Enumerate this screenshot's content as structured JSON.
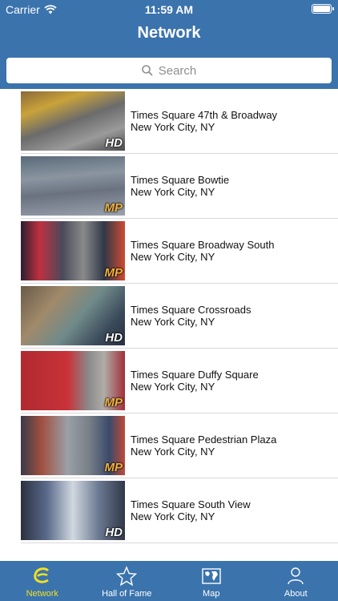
{
  "status_bar": {
    "carrier": "Carrier",
    "time": "11:59 AM"
  },
  "nav": {
    "title": "Network"
  },
  "search": {
    "placeholder": "Search"
  },
  "cameras": [
    {
      "name": "Times Square 47th & Broadway",
      "location": "New York City, NY",
      "quality": "HD"
    },
    {
      "name": "Times Square Bowtie",
      "location": "New York City, NY",
      "quality": "MP"
    },
    {
      "name": "Times Square Broadway South",
      "location": "New York City, NY",
      "quality": "MP"
    },
    {
      "name": "Times Square Crossroads",
      "location": "New York City, NY",
      "quality": "HD"
    },
    {
      "name": "Times Square Duffy Square",
      "location": "New York City, NY",
      "quality": "MP"
    },
    {
      "name": "Times Square Pedestrian Plaza",
      "location": "New York City, NY",
      "quality": "MP"
    },
    {
      "name": "Times Square South View",
      "location": "New York City, NY",
      "quality": "HD"
    }
  ],
  "tabs": [
    {
      "label": "Network",
      "icon": "network-icon",
      "active": true
    },
    {
      "label": "Hall of Fame",
      "icon": "star-icon",
      "active": false
    },
    {
      "label": "Map",
      "icon": "map-icon",
      "active": false
    },
    {
      "label": "About",
      "icon": "person-icon",
      "active": false
    }
  ],
  "colors": {
    "bar": "#3b73ad",
    "active_tab": "#f0e020",
    "mp_badge": "#f2b13a"
  }
}
